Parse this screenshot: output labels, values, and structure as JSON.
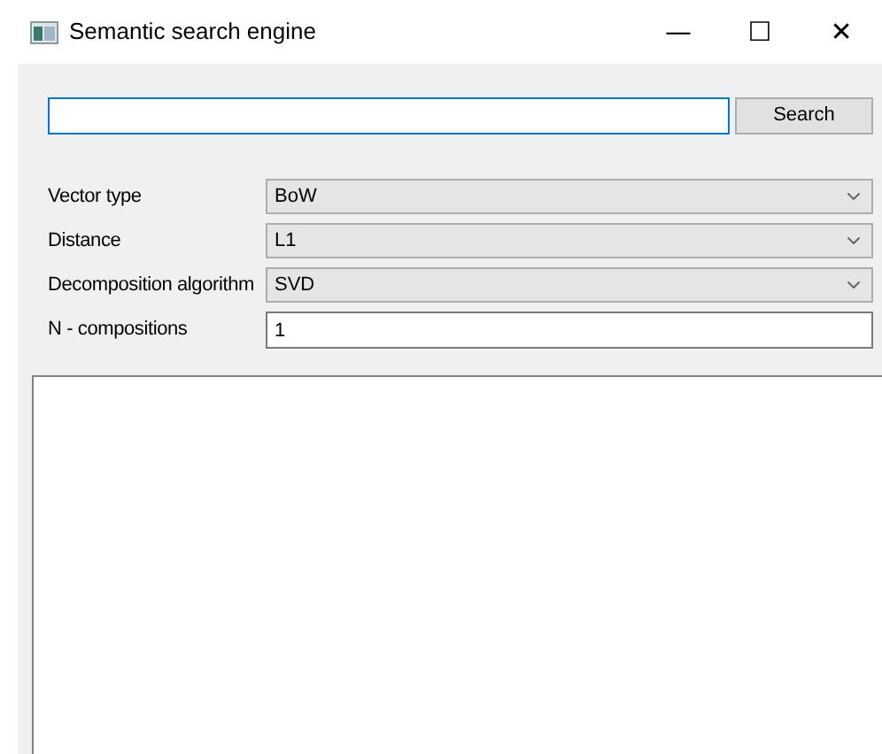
{
  "window": {
    "title": "Semantic search engine",
    "controls": [
      "—",
      "☐",
      "✕"
    ]
  },
  "search": {
    "button": "Search"
  },
  "settings": [
    {
      "kind": "combo",
      "label": "Vector type",
      "value": "BoW"
    },
    {
      "kind": "combo",
      "label": "Distance",
      "value": "L1"
    },
    {
      "kind": "combo",
      "label": "Decomposition algorithm",
      "value": "SVD"
    },
    {
      "kind": "text",
      "label": "N - compositions",
      "value": "1"
    }
  ]
}
